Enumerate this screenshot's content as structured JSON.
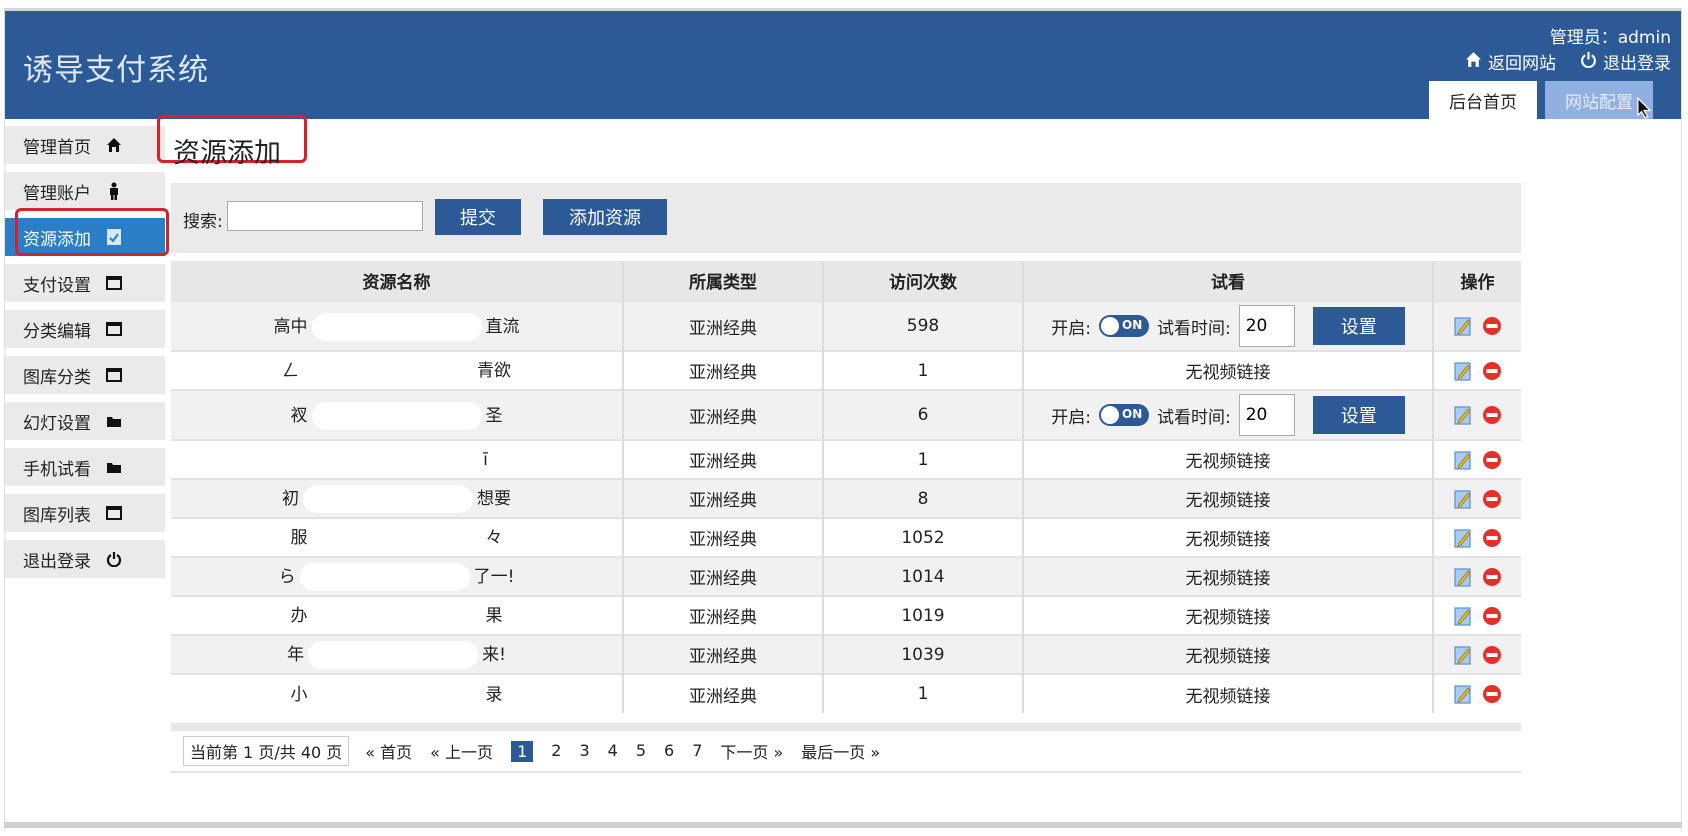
{
  "header": {
    "app_title": "诱导支付系统",
    "admin_label": "管理员：admin",
    "links": [
      {
        "label": "返回网站",
        "icon": "home-icon"
      },
      {
        "label": "退出登录",
        "icon": "power-icon"
      }
    ],
    "tabs": [
      {
        "label": "后台首页",
        "active": true
      },
      {
        "label": "网站配置",
        "active": false
      }
    ]
  },
  "sidebar": {
    "items": [
      {
        "label": "管理首页",
        "icon": "home-icon",
        "active": false
      },
      {
        "label": "管理账户",
        "icon": "user-icon",
        "active": false
      },
      {
        "label": "资源添加",
        "icon": "document-check-icon",
        "active": true
      },
      {
        "label": "支付设置",
        "icon": "window-icon",
        "active": false
      },
      {
        "label": "分类编辑",
        "icon": "window-icon",
        "active": false
      },
      {
        "label": "图库分类",
        "icon": "window-icon",
        "active": false
      },
      {
        "label": "幻灯设置",
        "icon": "folder-icon",
        "active": false
      },
      {
        "label": "手机试看",
        "icon": "folder-icon",
        "active": false
      },
      {
        "label": "图库列表",
        "icon": "window-icon",
        "active": false
      },
      {
        "label": "退出登录",
        "icon": "power-icon",
        "active": false
      }
    ]
  },
  "page": {
    "title": "资源添加"
  },
  "search": {
    "label": "搜索:",
    "value": "",
    "placeholder": "",
    "submit_label": "提交",
    "add_label": "添加资源"
  },
  "table": {
    "columns": [
      "资源名称",
      "所属类型",
      "访问次数",
      "试看",
      "操作"
    ],
    "rows": [
      {
        "name_start": "高中",
        "name_end": "直流",
        "type": "亚洲经典",
        "visits": "598",
        "trial": {
          "enabled": true,
          "open_label": "开启:",
          "toggle_label": "ON",
          "time_label": "试看时间:",
          "time_value": "20",
          "set_label": "设置"
        }
      },
      {
        "name_start": "ㄥ",
        "name_end": "青欲",
        "type": "亚洲经典",
        "visits": "1",
        "trial_text": "无视频链接"
      },
      {
        "name_start": "衩",
        "name_end": "圣",
        "type": "亚洲经典",
        "visits": "6",
        "trial": {
          "enabled": true,
          "open_label": "开启:",
          "toggle_label": "ON",
          "time_label": "试看时间:",
          "time_value": "20",
          "set_label": "设置"
        }
      },
      {
        "name_start": "",
        "name_end": "ī",
        "type": "亚洲经典",
        "visits": "1",
        "trial_text": "无视频链接"
      },
      {
        "name_start": "初",
        "name_end": "想要",
        "type": "亚洲经典",
        "visits": "8",
        "trial_text": "无视频链接"
      },
      {
        "name_start": "服",
        "name_end": "々",
        "type": "亚洲经典",
        "visits": "1052",
        "trial_text": "无视频链接"
      },
      {
        "name_start": "ら",
        "name_end": "了一!",
        "type": "亚洲经典",
        "visits": "1014",
        "trial_text": "无视频链接"
      },
      {
        "name_start": "办",
        "name_end": "果",
        "type": "亚洲经典",
        "visits": "1019",
        "trial_text": "无视频链接"
      },
      {
        "name_start": "年",
        "name_end": "来!",
        "type": "亚洲经典",
        "visits": "1039",
        "trial_text": "无视频链接"
      },
      {
        "name_start": "小",
        "name_end": "录",
        "type": "亚洲经典",
        "visits": "1",
        "trial_text": "无视频链接"
      }
    ],
    "op_icons": [
      "edit-icon",
      "delete-icon"
    ]
  },
  "pagination": {
    "info": "当前第 1 页/共 40 页",
    "first": "« 首页",
    "prev": "« 上一页",
    "pages": [
      "1",
      "2",
      "3",
      "4",
      "5",
      "6",
      "7"
    ],
    "current": "1",
    "next": "下一页 »",
    "last": "最后一页 »"
  },
  "colors": {
    "header_bg": "#2c5a97",
    "active_sidebar": "#2b7fc6",
    "button": "#2c5a97",
    "highlight": "#d6232b",
    "delete": "#e2312b"
  }
}
